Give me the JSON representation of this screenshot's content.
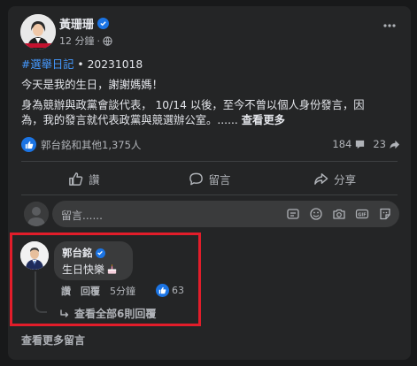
{
  "post": {
    "author": "黃珊珊",
    "time": "12 分鐘",
    "hashtag": "#選舉日記",
    "date_suffix": " • 20231018",
    "line1": "今天是我的生日，謝謝媽媽！",
    "line2": "身為競辦與政黨會談代表， 10/14 以後，至今不曾以個人身份發言，因",
    "line3_prefix": "為，我的發言就代表政黨與競選辦公室。...... ",
    "see_more": "查看更多",
    "reactions_text": "郭台銘和其他1,375人",
    "comment_count": "184",
    "share_count": "23"
  },
  "actions": {
    "like": "讚",
    "comment": "留言",
    "share": "分享"
  },
  "composer": {
    "placeholder": "留言......"
  },
  "comment": {
    "author": "郭台銘",
    "text": "生日快樂",
    "like_label": "讚",
    "reply_label": "回覆",
    "time": "5分鐘",
    "like_count": "63",
    "view_replies": "查看全部6則回覆"
  },
  "footer": {
    "view_more_comments": "查看更多留言"
  },
  "colors": {
    "accent": "#1b74e4",
    "link": "#4599ff",
    "highlight_border": "#e21d2a"
  },
  "icons": [
    "avatar-photo",
    "verified-badge-icon",
    "globe-icon",
    "more-icon",
    "like-reaction-icon",
    "comment-icon",
    "share-icon",
    "like-icon",
    "sticker-icon",
    "emoji-icon",
    "camera-icon",
    "gif-icon",
    "avatar-sticker-icon",
    "birthday-cake-emoji",
    "reply-arrow-icon"
  ]
}
